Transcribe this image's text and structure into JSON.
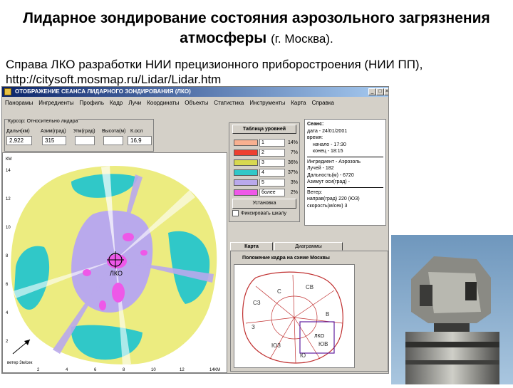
{
  "slide": {
    "title_main": "Лидарное зондирование состояния аэрозольного загрязнения атмосферы",
    "title_sub": "(г. Москва).",
    "credit_line1": "Справа ЛКО разработки НИИ прецизионного приборостроения (НИИ ПП),",
    "credit_line2": "http://citysoft.mosmap.ru/Lidar/Lidar.htm"
  },
  "window": {
    "title": "ОТОБРАЖЕНИЕ СЕАНСА ЛИДАРНОГО ЗОНДИРОВАНИЯ    (ЛКО)",
    "buttons": {
      "minimize": "_",
      "maximize": "□",
      "close": "×"
    },
    "menu": [
      "Панорамы",
      "Ингредиенты",
      "Профиль",
      "Кадр",
      "Лучи",
      "Координаты",
      "Объекты",
      "Статистика",
      "Инструменты",
      "Карта",
      "Справка"
    ]
  },
  "cursor": {
    "caption": "Курсор: Относительно лидара",
    "labels": {
      "dist": "Дальн(км)",
      "azimuth": "Азим(град)",
      "elevation": "Угм(град)",
      "height": "Высота(м)",
      "kosl": "К.осл"
    },
    "values": {
      "dist": "2,922",
      "azimuth": "315",
      "elevation": "",
      "height": "",
      "kosl": "16,9"
    }
  },
  "radar": {
    "y_axis_label": "КМ",
    "y_ticks": [
      "14",
      "12",
      "10",
      "8",
      "6",
      "4",
      "2"
    ],
    "x_ticks": [
      "2",
      "4",
      "6",
      "8",
      "10",
      "12",
      "14КМ"
    ],
    "center_label": "ЛКО",
    "wind_label": "ветер 3м/сек",
    "colors": {
      "light_yellow": "#ecec80",
      "cyan": "#30c8c8",
      "violet": "#b9a9ec",
      "magenta": "#ee58e8",
      "white": "#ffffff"
    }
  },
  "levels": {
    "header": "Таблица уровней",
    "rows": [
      {
        "name": "1",
        "percent": "14%",
        "color": "#f8b090"
      },
      {
        "name": "2",
        "percent": "7%",
        "color": "#ee4030"
      },
      {
        "name": "3",
        "percent": "36%",
        "color": "#d8d850"
      },
      {
        "name": "4",
        "percent": "37%",
        "color": "#30c8c8"
      },
      {
        "name": "5",
        "percent": "3%",
        "color": "#b9a9ec"
      },
      {
        "name": "более",
        "percent": "2%",
        "color": "#ee58e8"
      }
    ],
    "install_button": "Установка",
    "fix_scale_label": "Фиксировать шкалу"
  },
  "session": {
    "heading": "Сеанс:",
    "date": "дата - 24/01/2001",
    "time_label": "время:",
    "start": "начало - 17:30",
    "end": "конец    - 18:15",
    "ingredient": "Ингредиент - Аэрозоль",
    "beams": "Лучей - 182",
    "range": "Дальность(м) - 6720",
    "axis_azimuth": "Азимут оси(град) -",
    "wind_heading": "Ветер:",
    "wind_direction": "направ(град)  220 (ЮЗ)",
    "wind_speed": "скорость(м/сек)  3"
  },
  "map": {
    "tabs": [
      "Карта",
      "Диаграммы"
    ],
    "caption": "Положение кадра на схеме Москвы",
    "districts": [
      "С",
      "СВ",
      "СЗ",
      "В",
      "З",
      "ЮВ",
      "ЮЗ",
      "Ю",
      "ЛКО"
    ]
  }
}
